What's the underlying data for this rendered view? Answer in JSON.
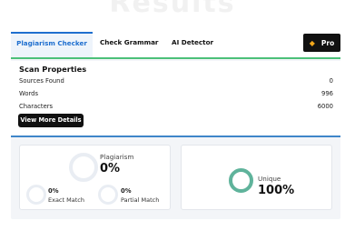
{
  "background_heading": "Results",
  "tabs": [
    {
      "label": "Plagiarism Checker",
      "active": true
    },
    {
      "label": "Check Grammar",
      "active": false
    },
    {
      "label": "AI Detector",
      "active": false
    }
  ],
  "pro": {
    "label": "Pro",
    "icon": "diamond-icon",
    "icon_color": "#f2a71b"
  },
  "scan_properties": {
    "title": "Scan Properties",
    "rows": [
      {
        "label": "Sources Found",
        "value": "0"
      },
      {
        "label": "Words",
        "value": "996"
      },
      {
        "label": "Characters",
        "value": "6000"
      }
    ],
    "details_button": "View More Details"
  },
  "plagiarism": {
    "label": "Plagiarism",
    "value": "0%",
    "exact": {
      "value": "0%",
      "label": "Exact Match"
    },
    "partial": {
      "value": "0%",
      "label": "Partial Match"
    }
  },
  "unique": {
    "label": "Unique",
    "value": "100%",
    "color": "#5fb39b"
  }
}
